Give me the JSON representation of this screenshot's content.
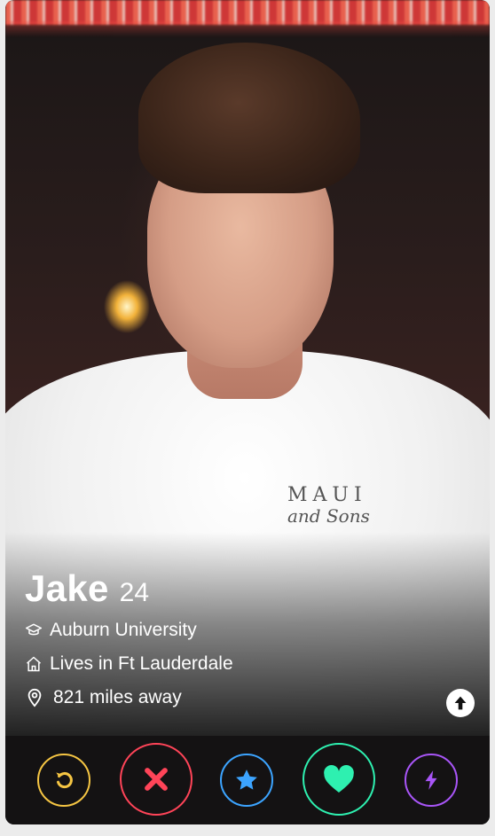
{
  "profile": {
    "name": "Jake",
    "age": "24",
    "school": "Auburn University",
    "lives": "Lives in Ft Lauderdale",
    "distance": "821 miles away",
    "shirt_text_top": "MAUI",
    "shirt_text_bottom": "and Sons"
  },
  "icons": {
    "school": "graduation-cap-icon",
    "home": "house-icon",
    "location": "location-pin-icon",
    "expand": "arrow-up-icon"
  },
  "actions": [
    {
      "name": "rewind",
      "icon": "rewind-icon",
      "color": "#f5c543"
    },
    {
      "name": "nope",
      "icon": "close-icon",
      "color": "#ff4458"
    },
    {
      "name": "super-like",
      "icon": "star-icon",
      "color": "#3ca4ff"
    },
    {
      "name": "like",
      "icon": "heart-icon",
      "color": "#2ef0b0"
    },
    {
      "name": "boost",
      "icon": "lightning-icon",
      "color": "#a855f7"
    }
  ]
}
